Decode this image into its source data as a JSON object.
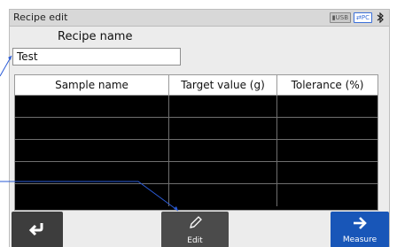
{
  "window": {
    "title": "Recipe edit"
  },
  "status": {
    "usb_label": "USB",
    "pc_label": "PC",
    "usb_icon": "usb-icon",
    "pc_icon": "pc-connection-icon",
    "bluetooth_icon": "bluetooth-icon"
  },
  "recipe": {
    "name_label": "Recipe name",
    "name_value": "Test"
  },
  "table": {
    "columns": [
      "Sample name",
      "Target value (g)",
      "Tolerance (%)"
    ],
    "rows": [
      [
        "",
        "",
        ""
      ],
      [
        "",
        "",
        ""
      ],
      [
        "",
        "",
        ""
      ],
      [
        "",
        "",
        ""
      ],
      [
        "",
        "",
        ""
      ]
    ]
  },
  "toolbar": {
    "back_icon": "return-arrow-icon",
    "edit_label": "Edit",
    "edit_icon": "pencil-icon",
    "measure_label": "Measure",
    "measure_icon": "arrow-right-icon"
  },
  "colors": {
    "measure_button": "#1856b8",
    "callout_line": "#2a5bd7",
    "accent_pc": "#3a6fd8"
  }
}
